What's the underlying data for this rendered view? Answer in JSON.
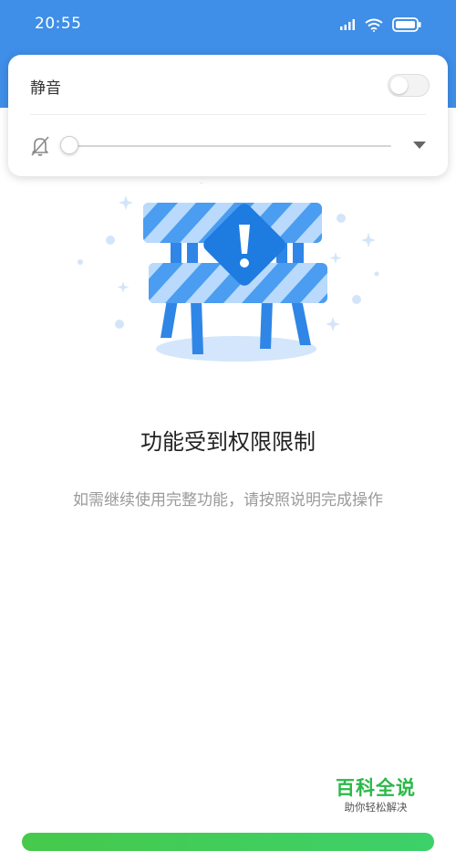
{
  "status_bar": {
    "time": "20:55",
    "icons": [
      "signal-icon",
      "wifi-icon",
      "battery-icon"
    ]
  },
  "volume_panel": {
    "mute_label": "静音",
    "mute_toggle_on": false,
    "volume_level": 0,
    "icons": [
      "muted-bell-icon",
      "chevron-down-icon"
    ]
  },
  "main": {
    "title": "功能受到权限限制",
    "subtitle": "如需继续使用完整功能，请按照说明完成操作",
    "illustration": "barricade-warning-illustration"
  },
  "watermark": {
    "title": "百科全说",
    "subtitle": "助你轻松解决"
  },
  "colors": {
    "header": "#3f8ee8",
    "barrier_blue": "#4a9df0",
    "watermark_green": "#2bb848",
    "bottom_button": "#46c94b"
  }
}
